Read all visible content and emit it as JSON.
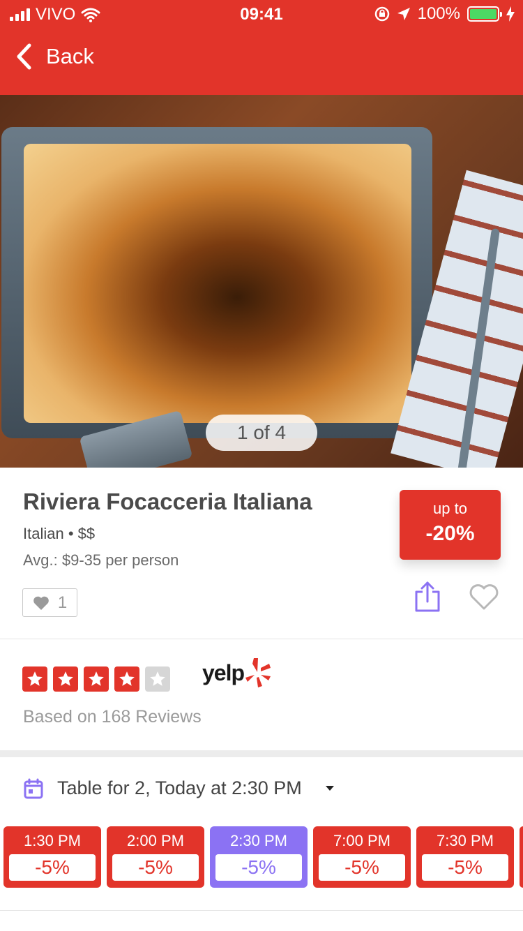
{
  "status_bar": {
    "carrier": "VIVO",
    "time": "09:41",
    "battery": "100%"
  },
  "nav": {
    "back_label": "Back"
  },
  "gallery": {
    "counter": "1 of 4"
  },
  "restaurant": {
    "name": "Riviera Focacceria Italiana",
    "cuisine_price": "Italian • $$",
    "avg_price": "Avg.: $9-35 per person",
    "likes": "1",
    "promo": {
      "top": "up to",
      "value": "-20%"
    }
  },
  "rating": {
    "stars": 4,
    "max_stars": 5,
    "provider": "yelp",
    "reviews_text": "Based on 168 Reviews"
  },
  "reservation": {
    "label": "Table for 2, Today at 2:30 PM",
    "slots": [
      {
        "time": "1:30 PM",
        "discount": "-5%"
      },
      {
        "time": "2:00 PM",
        "discount": "-5%"
      },
      {
        "time": "2:30 PM",
        "discount": "-5%"
      },
      {
        "time": "7:00 PM",
        "discount": "-5%"
      },
      {
        "time": "7:30 PM",
        "discount": "-5%"
      }
    ],
    "selected_index": 2
  },
  "colors": {
    "brand": "#E2342A",
    "accent": "#8B72F3"
  }
}
